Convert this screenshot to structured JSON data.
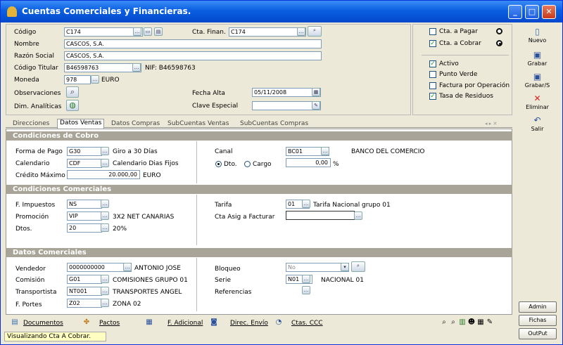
{
  "window": {
    "title": "Cuentas Comerciales y Financieras.",
    "min": "_",
    "max": "□",
    "close": "✕"
  },
  "header": {
    "codigo_label": "Código",
    "codigo_value": "C174",
    "cta_finan_label": "Cta. Finan.",
    "cta_finan_value": "C174",
    "nombre_label": "Nombre",
    "nombre_value": "CASCOS, S.A.",
    "razon_label": "Razón Social",
    "razon_value": "CASCOS, S.A.",
    "titular_label": "Código Titular",
    "titular_value": "B46598763",
    "nif_text": "NIF: B46598763",
    "moneda_label": "Moneda",
    "moneda_value": "978",
    "moneda_text": "EURO",
    "obs_label": "Observaciones",
    "dim_label": "Dim. Analíticas",
    "fecha_alta_label": "Fecha Alta",
    "fecha_alta_value": "05/11/2008",
    "clave_label": "Clave Especial",
    "clave_value": ""
  },
  "checks": {
    "cta_pagar": {
      "label": "Cta. a Pagar",
      "checked": false
    },
    "cta_cobrar": {
      "label": "Cta. a Cobrar",
      "checked": true
    },
    "activo": {
      "label": "Activo",
      "checked": true
    },
    "punto_verde": {
      "label": "Punto Verde",
      "checked": false
    },
    "factura_op": {
      "label": "Factura por Operación",
      "checked": false
    },
    "tasa": {
      "label": "Tasa de Residuos",
      "checked": true
    }
  },
  "toolbar": {
    "nuevo": "Nuevo",
    "grabar": "Grabar",
    "grabar_s": "Grabar/S",
    "eliminar": "Eliminar",
    "salir": "Salir"
  },
  "tabs": [
    "Direcciones",
    "Datos Ventas",
    "Datos Compras",
    "SubCuentas Ventas",
    "SubCuentas Compras"
  ],
  "cobro": {
    "title": "Condiciones de Cobro",
    "forma_label": "Forma de Pago",
    "forma_value": "G30",
    "forma_text": "Giro a 30 Días",
    "cal_label": "Calendario",
    "cal_value": "CDF",
    "cal_text": "Calendario Dias Fijos",
    "credito_label": "Crédito Máximo",
    "credito_value": "20.000,00",
    "credito_text": "EURO",
    "canal_label": "Canal",
    "canal_value": "BC01",
    "canal_text": "BANCO DEL COMERCIO",
    "dto_label": "Dto.",
    "cargo_label": "Cargo",
    "pct_value": "0,00",
    "pct_sign": "%"
  },
  "comerciales": {
    "title": "Condiciones Comerciales",
    "imp_label": "F. Impuestos",
    "imp_value": "NS",
    "promo_label": "Promoción",
    "promo_value": "VIP",
    "promo_text": "3X2  NET CANARIAS",
    "dtos_label": "Dtos.",
    "dtos_value": "20",
    "dtos_text": "20%",
    "tarifa_label": "Tarifa",
    "tarifa_value": "01",
    "tarifa_text": "Tarifa Nacional grupo 01",
    "asig_label": "Cta Asig a Facturar",
    "asig_value": ""
  },
  "datos": {
    "title": "Datos Comerciales",
    "vend_label": "Vendedor",
    "vend_value": "0000000000",
    "vend_text": "ANTONIO JOSE",
    "com_label": "Comisión",
    "com_value": "G01",
    "com_text": "COMISIONES GRUPO 01",
    "trans_label": "Transportista",
    "trans_value": "NT001",
    "trans_text": "TRANSPORTES ANGEL",
    "portes_label": "F. Portes",
    "portes_value": "Z02",
    "portes_text": "ZONA 02",
    "bloq_label": "Bloqueo",
    "bloq_value": "No",
    "serie_label": "Serie",
    "serie_value": "N01",
    "serie_text": "NACIONAL 01",
    "ref_label": "Referencias"
  },
  "bottom": {
    "documentos": "Documentos",
    "pactos": "Pactos",
    "f_adicional": "F. Adicional",
    "direc_envio": "Direc. Envío",
    "ctas_ccc": "Ctas. CCC"
  },
  "side": {
    "admin": "Admin",
    "fichas": "Fichas",
    "output": "OutPut"
  },
  "status": "Visualizando Cta A Cobrar."
}
